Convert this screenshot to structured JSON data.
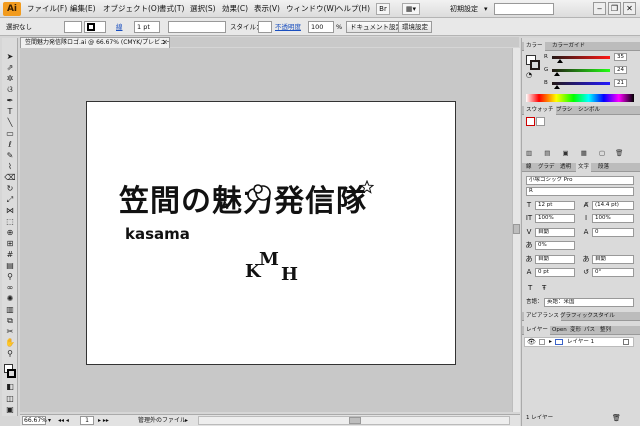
{
  "menubar": {
    "app": "Ai",
    "items": [
      "ファイル(F)",
      "編集(E)",
      "オブジェクト(O)",
      "書式(T)",
      "選択(S)",
      "効果(C)",
      "表示(V)",
      "ウィンドウ(W)",
      "ヘルプ(H)"
    ],
    "workspace": "初期設定"
  },
  "controlbar": {
    "selection": "選択なし",
    "stroke_label": "線",
    "stroke_weight": "1 pt",
    "style_label": "スタイル：",
    "opacity_label": "不透明度",
    "opacity_value": "100",
    "opacity_unit": "%",
    "doc_settings": "ドキュメント設定",
    "preferences": "環境設定"
  },
  "document": {
    "tab_title": "笠間魅力発信隊ロゴ.ai @ 66.67% (CMYK/プレビュー)",
    "close": "×",
    "artwork": {
      "logo_text": "笠間の魅力発信隊",
      "sub_text": "kasama",
      "monogram": [
        "K",
        "M",
        "H"
      ]
    }
  },
  "statusbar": {
    "zoom": "66.67%",
    "page": "1",
    "status_text": "管理外のファイル"
  },
  "panels": {
    "color": {
      "tab_color": "カラー",
      "tab_guide": "カラーガイド",
      "channels": [
        {
          "label": "R",
          "value": "35",
          "level": 0.14,
          "color": "#c9302c"
        },
        {
          "label": "G",
          "value": "24",
          "level": 0.09,
          "color": "#3aa53a"
        },
        {
          "label": "B",
          "value": "21",
          "level": 0.08,
          "color": "#2d55c8"
        }
      ]
    },
    "swatches": {
      "tab_swatch": "スウォッチ",
      "tab_brush": "ブラシ",
      "tab_symbol": "シンボル"
    },
    "character": {
      "tabs": [
        "線",
        "グラデ",
        "透明",
        "文字",
        "段落"
      ],
      "font_family": "小塚ゴシック Pro",
      "font_style": "R",
      "font_size": "12 pt",
      "leading": "(14.4 pt)",
      "vscale": "100%",
      "hscale": "100%",
      "kerning": "自動",
      "tracking": "0",
      "tsume": "0%",
      "aki_left": "自動",
      "aki_right": "自動",
      "baseline": "0 pt",
      "rotation": "0°",
      "language_label": "言語：",
      "language": "英語：米国"
    },
    "appearance": {
      "tab_appearance": "アピアランス",
      "tab_graphic_style": "グラフィックスタイル"
    },
    "layers": {
      "tabs": [
        "レイヤー",
        "Open",
        "変形",
        "パス",
        "整列"
      ],
      "layer_name": "レイヤー 1",
      "footer": "1 レイヤー"
    }
  }
}
